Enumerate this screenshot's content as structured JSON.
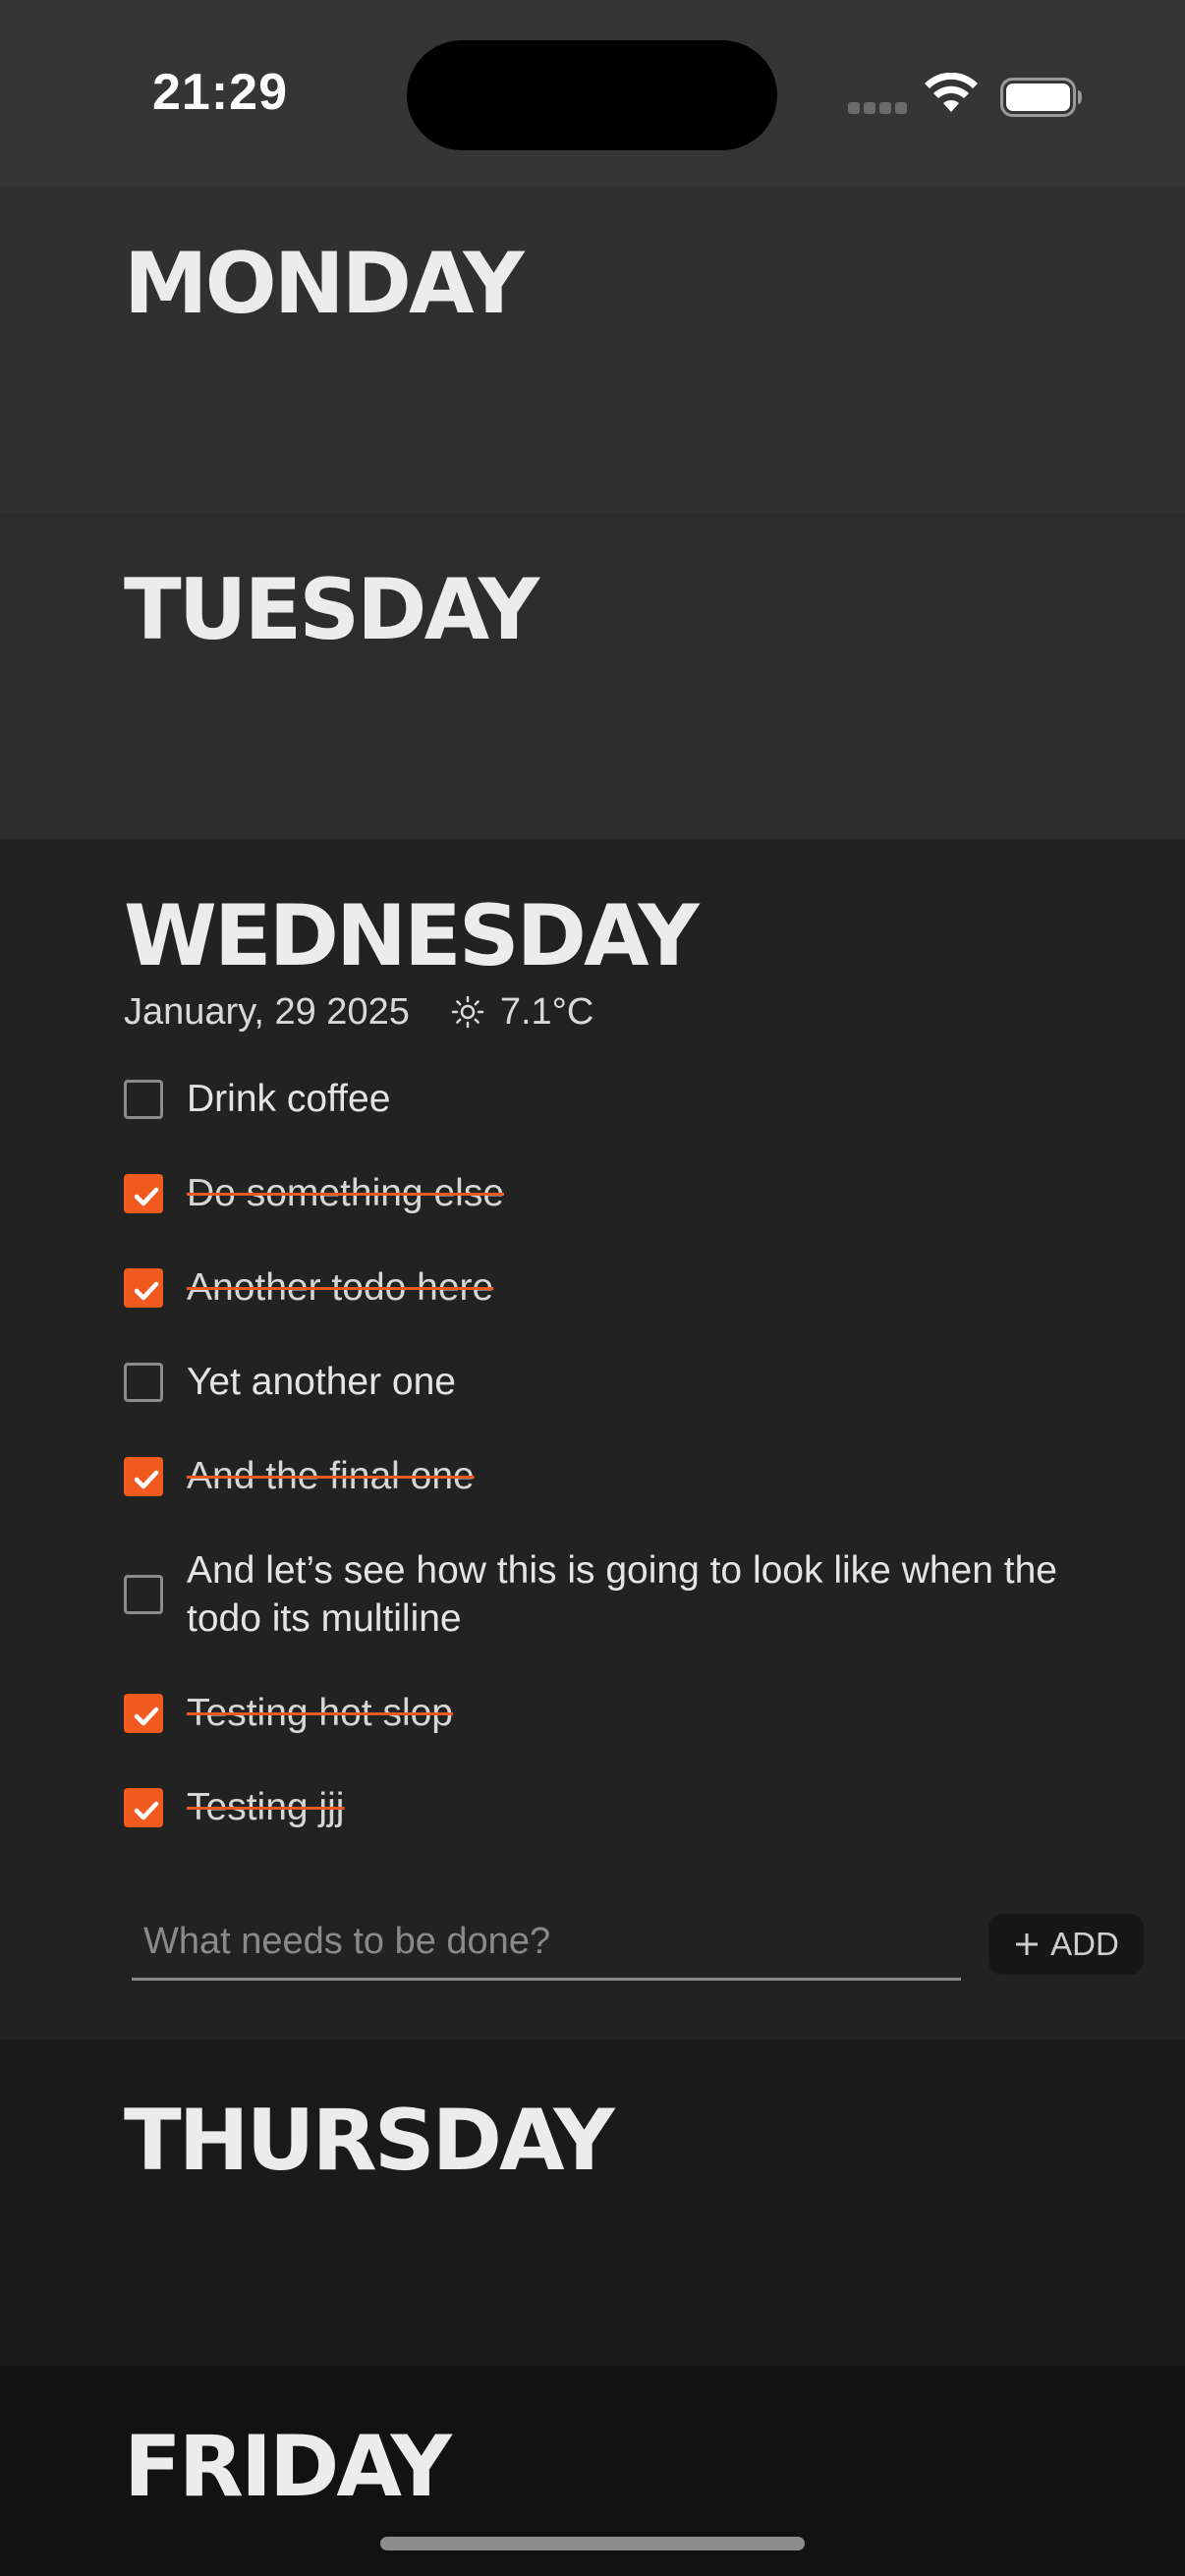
{
  "status_bar": {
    "time": "21:29",
    "icons": [
      "cellular-signal-icon",
      "wifi-icon",
      "battery-icon"
    ]
  },
  "days": {
    "monday": {
      "title": "MONDAY"
    },
    "tuesday": {
      "title": "TUESDAY"
    },
    "wednesday": {
      "title": "WEDNESDAY",
      "date": "January, 29 2025",
      "weather_icon": "sun-icon",
      "temperature": "7.1°C",
      "todos": [
        {
          "text": "Drink coffee",
          "done": false
        },
        {
          "text": "Do something else",
          "done": true
        },
        {
          "text": "Another todo here",
          "done": true
        },
        {
          "text": "Yet another one",
          "done": false
        },
        {
          "text": "And the final one",
          "done": true
        },
        {
          "text": "And let’s see how this is going to look like when the todo its multiline",
          "done": false
        },
        {
          "text": "Testing hot slop",
          "done": true
        },
        {
          "text": "Testing jjj",
          "done": true
        }
      ],
      "input_placeholder": "What needs to be done?",
      "input_value": "",
      "add_label": "ADD"
    },
    "thursday": {
      "title": "THURSDAY"
    },
    "friday": {
      "title": "FRIDAY"
    }
  },
  "colors": {
    "accent": "#f05a1e",
    "text": "#ececec",
    "background": "#1b1b1b"
  }
}
